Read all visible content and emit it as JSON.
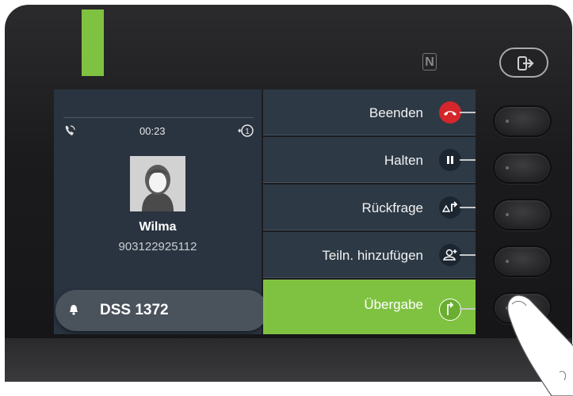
{
  "call": {
    "timer": "00:23",
    "caller_name": "Wilma",
    "caller_number": "903122925112"
  },
  "dss": {
    "label": "DSS 1372"
  },
  "menu": {
    "items": [
      {
        "label": "Beenden",
        "icon": "hangup-icon"
      },
      {
        "label": "Halten",
        "icon": "pause-icon"
      },
      {
        "label": "Rückfrage",
        "icon": "consult-icon"
      },
      {
        "label": "Teiln. hinzufügen",
        "icon": "add-participant-icon"
      },
      {
        "label": "Übergabe",
        "icon": "transfer-icon",
        "selected": true
      }
    ]
  },
  "colors": {
    "accent_green": "#7fc241",
    "hangup_red": "#d4262b",
    "panel_bg": "#2d3945"
  }
}
